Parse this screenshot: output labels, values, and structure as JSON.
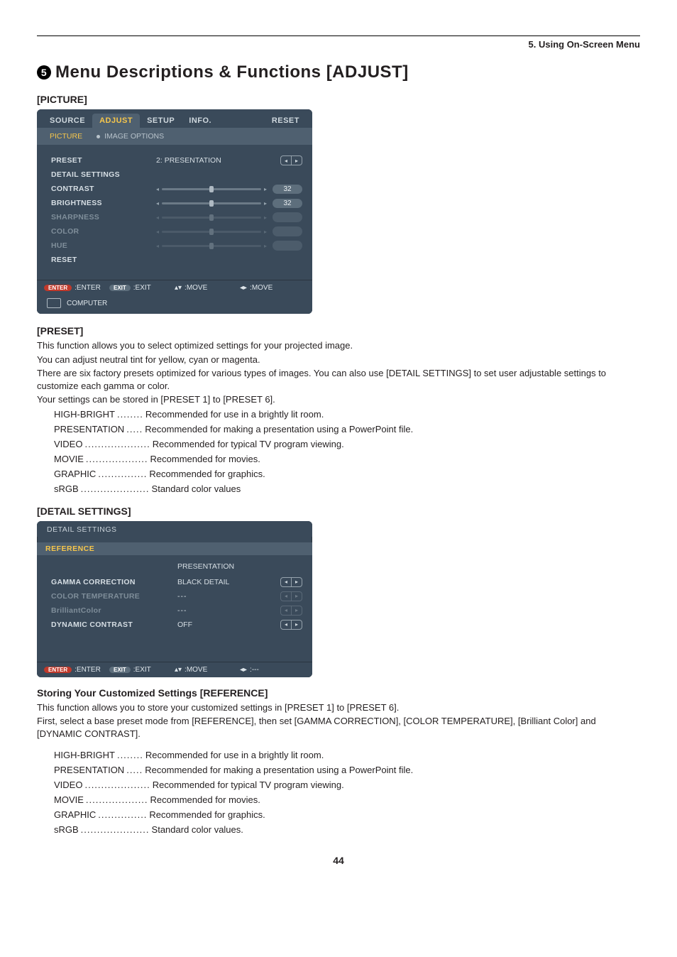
{
  "running_head": "5. Using On-Screen Menu",
  "section_number": "5",
  "h1": "Menu Descriptions & Functions [ADJUST]",
  "picture_heading": "[PICTURE]",
  "osd1": {
    "tabs": [
      "SOURCE",
      "ADJUST",
      "SETUP",
      "INFO.",
      "RESET"
    ],
    "active_tab": "ADJUST",
    "subtabs": [
      "PICTURE",
      "IMAGE OPTIONS"
    ],
    "active_subtab": "PICTURE",
    "rows": {
      "preset_label": "PRESET",
      "preset_value_prefix": "2:",
      "preset_value": "PRESENTATION",
      "detail": "DETAIL SETTINGS",
      "contrast": "CONTRAST",
      "contrast_val": "32",
      "brightness": "BRIGHTNESS",
      "brightness_val": "32",
      "sharpness": "SHARPNESS",
      "color": "COLOR",
      "hue": "HUE",
      "reset": "RESET"
    },
    "hints": {
      "enter": "ENTER",
      "enter_lbl": ":ENTER",
      "exit": "EXIT",
      "exit_lbl": ":EXIT",
      "move_ud": ":MOVE",
      "move_lr": ":MOVE"
    },
    "source": "COMPUTER"
  },
  "preset": {
    "heading": "[PRESET]",
    "p1": "This function allows you to select optimized settings for your projected image.",
    "p2": "You can adjust neutral tint for yellow, cyan or magenta.",
    "p3": "There are six factory presets optimized for various types of images. You can also use [DETAIL SETTINGS] to set user adjustable settings to customize each gamma or color.",
    "p4": "Your settings can be stored in [PRESET 1] to [PRESET 6].",
    "items": [
      {
        "term": "HIGH-BRIGHT",
        "dots": "........",
        "desc": "Recommended for use in a brightly lit room."
      },
      {
        "term": "PRESENTATION",
        "dots": ".....",
        "desc": "Recommended for making a presentation using a PowerPoint file."
      },
      {
        "term": "VIDEO",
        "dots": "....................",
        "desc": "Recommended for typical TV program viewing."
      },
      {
        "term": "MOVIE",
        "dots": "...................",
        "desc": "Recommended for movies."
      },
      {
        "term": "GRAPHIC",
        "dots": "...............",
        "desc": "Recommended for graphics."
      },
      {
        "term": "sRGB",
        "dots": ".....................",
        "desc": "Standard color values"
      }
    ]
  },
  "detail_heading": "[DETAIL SETTINGS]",
  "osd2": {
    "title": "DETAIL SETTINGS",
    "ref_tab": "REFERENCE",
    "rows": {
      "gamma": "GAMMA CORRECTION",
      "gamma_val": "BLACK DETAIL",
      "color_temp": "COLOR TEMPERATURE",
      "color_temp_val": "---",
      "brilliant": "BrilliantColor",
      "brilliant_val": "---",
      "dyn": "DYNAMIC CONTRAST",
      "dyn_val": "OFF",
      "ref_val": "PRESENTATION"
    },
    "hints": {
      "enter": "ENTER",
      "enter_lbl": ":ENTER",
      "exit": "EXIT",
      "exit_lbl": ":EXIT",
      "move_ud": ":MOVE",
      "move_lr": ":---"
    }
  },
  "reference": {
    "heading": "Storing Your Customized Settings [REFERENCE]",
    "p1": "This function allows you to store your customized settings in [PRESET 1] to [PRESET 6].",
    "p2": "First, select a base preset mode from [REFERENCE], then set [GAMMA CORRECTION], [COLOR TEMPERATURE], [Brilliant Color] and [DYNAMIC CONTRAST].",
    "items": [
      {
        "term": "HIGH-BRIGHT",
        "dots": "........",
        "desc": "Recommended for use in a brightly lit room."
      },
      {
        "term": "PRESENTATION",
        "dots": ".....",
        "desc": "Recommended for making a presentation using a PowerPoint file."
      },
      {
        "term": "VIDEO",
        "dots": "....................",
        "desc": "Recommended for typical TV program viewing."
      },
      {
        "term": "MOVIE",
        "dots": "...................",
        "desc": "Recommended for movies."
      },
      {
        "term": "GRAPHIC",
        "dots": "...............",
        "desc": "Recommended for graphics."
      },
      {
        "term": "sRGB",
        "dots": ".....................",
        "desc": "Standard color values."
      }
    ]
  },
  "page_number": "44"
}
